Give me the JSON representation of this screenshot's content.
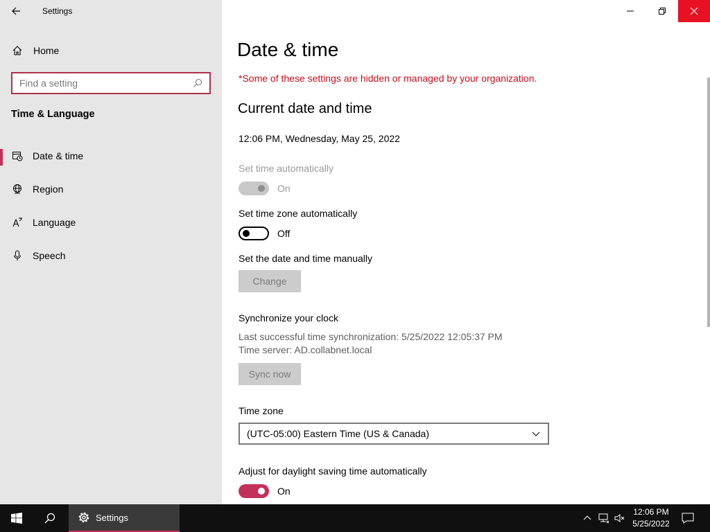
{
  "window": {
    "app_title": "Settings"
  },
  "sidebar": {
    "home_label": "Home",
    "search_placeholder": "Find a setting",
    "section_title": "Time & Language",
    "items": [
      {
        "label": "Date & time",
        "icon": "calendar-clock-icon",
        "active": true
      },
      {
        "label": "Region",
        "icon": "globe-icon",
        "active": false
      },
      {
        "label": "Language",
        "icon": "language-icon",
        "active": false
      },
      {
        "label": "Speech",
        "icon": "microphone-icon",
        "active": false
      }
    ]
  },
  "main": {
    "title": "Date & time",
    "warning": "*Some of these settings are hidden or managed by your organization.",
    "current_heading": "Current date and time",
    "current_value": "12:06 PM, Wednesday, May 25, 2022",
    "set_time_auto": {
      "label": "Set time automatically",
      "state": "On",
      "enabled": false
    },
    "set_tz_auto": {
      "label": "Set time zone automatically",
      "state": "Off",
      "enabled": true
    },
    "manual": {
      "label": "Set the date and time manually",
      "button": "Change"
    },
    "sync": {
      "heading": "Synchronize your clock",
      "last_sync": "Last successful time synchronization: 5/25/2022 12:05:37 PM",
      "server": "Time server: AD.collabnet.local",
      "button": "Sync now"
    },
    "timezone": {
      "label": "Time zone",
      "value": "(UTC-05:00) Eastern Time (US & Canada)"
    },
    "dst": {
      "label": "Adjust for daylight saving time automatically",
      "state": "On"
    }
  },
  "taskbar": {
    "app_label": "Settings",
    "time": "12:06 PM",
    "date": "5/25/2022"
  },
  "colors": {
    "accent": "#c3305a",
    "warning": "#c50f1f",
    "close": "#e81123"
  }
}
